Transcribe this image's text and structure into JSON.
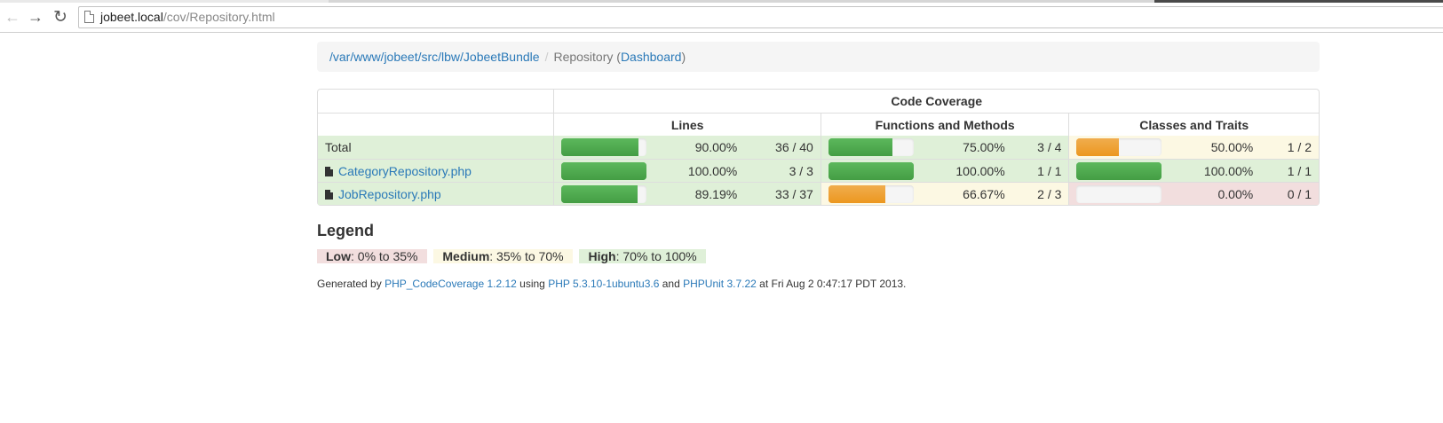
{
  "browser": {
    "url_host": "jobeet.local",
    "url_path": "/cov/Repository.html",
    "back_glyph": "←",
    "forward_glyph": "→",
    "reload_glyph": "↻"
  },
  "breadcrumb": {
    "path_link": "/var/www/jobeet/src/lbw/JobeetBundle",
    "separator": "/",
    "current": "Repository",
    "open_paren": "(",
    "dashboard_link": "Dashboard",
    "close_paren": ")"
  },
  "table": {
    "header_main": "Code Coverage",
    "header_lines": "Lines",
    "header_functions": "Functions and Methods",
    "header_classes": "Classes and Traits",
    "rows": [
      {
        "name": "Total",
        "is_link": false,
        "lines": {
          "pct": "90.00%",
          "num": "36 / 40",
          "level": 0.9,
          "class": "success"
        },
        "functions": {
          "pct": "75.00%",
          "num": "3 / 4",
          "level": 0.75,
          "class": "success"
        },
        "classes": {
          "pct": "50.00%",
          "num": "1 / 2",
          "level": 0.5,
          "class": "warning"
        }
      },
      {
        "name": "CategoryRepository.php",
        "is_link": true,
        "lines": {
          "pct": "100.00%",
          "num": "3 / 3",
          "level": 1.0,
          "class": "success"
        },
        "functions": {
          "pct": "100.00%",
          "num": "1 / 1",
          "level": 1.0,
          "class": "success"
        },
        "classes": {
          "pct": "100.00%",
          "num": "1 / 1",
          "level": 1.0,
          "class": "success"
        }
      },
      {
        "name": "JobRepository.php",
        "is_link": true,
        "lines": {
          "pct": "89.19%",
          "num": "33 / 37",
          "level": 0.8919,
          "class": "success"
        },
        "functions": {
          "pct": "66.67%",
          "num": "2 / 3",
          "level": 0.6667,
          "class": "warning"
        },
        "classes": {
          "pct": "0.00%",
          "num": "0 / 1",
          "level": 0.0,
          "class": "danger"
        }
      }
    ]
  },
  "legend": {
    "title": "Legend",
    "low_label": "Low",
    "low_range": ": 0% to 35%",
    "medium_label": "Medium",
    "medium_range": ": 35% to 70%",
    "high_label": "High",
    "high_range": ": 70% to 100%"
  },
  "footer": {
    "prefix": "Generated by ",
    "tool_link": "PHP_CodeCoverage 1.2.12",
    "using": " using ",
    "php_link": "PHP 5.3.10-1ubuntu3.6",
    "and": " and ",
    "phpunit_link": "PHPUnit 3.7.22",
    "suffix": " at Fri Aug 2 0:47:17 PDT 2013."
  },
  "colors": {
    "success_bg": "#dff0d8",
    "warning_bg": "#fcf8e3",
    "danger_bg": "#f2dede",
    "bar_success": "#5cb85c",
    "bar_warning": "#f0ad4e",
    "link": "#2a79b8"
  }
}
